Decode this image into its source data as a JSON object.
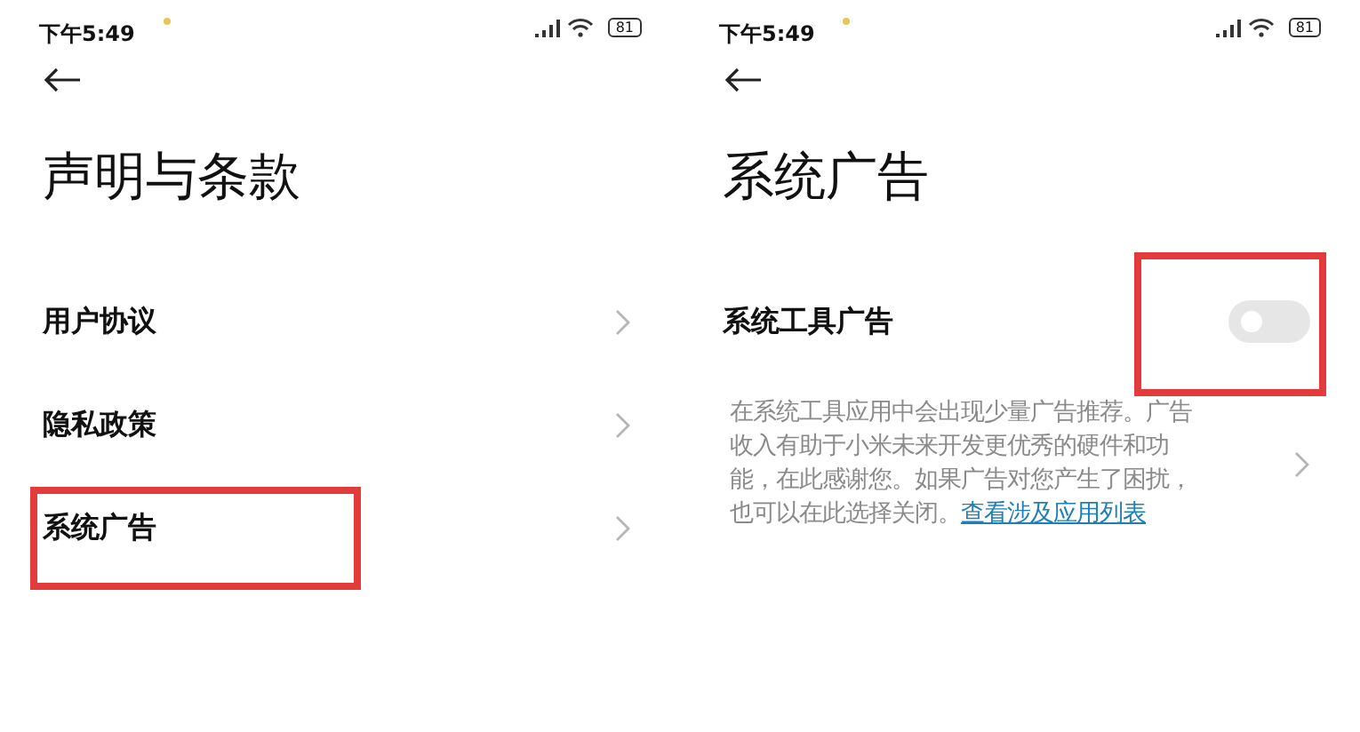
{
  "screens": [
    {
      "status_bar": {
        "time": "下午5:49",
        "battery": "81"
      },
      "title": "声明与条款",
      "items": [
        {
          "kind": "link",
          "label": "用户协议",
          "highlighted": false
        },
        {
          "kind": "link",
          "label": "隐私政策",
          "highlighted": false
        },
        {
          "kind": "link",
          "label": "系统广告",
          "highlighted": true
        }
      ]
    },
    {
      "status_bar": {
        "time": "下午5:49",
        "battery": "81"
      },
      "title": "系统广告",
      "items": [
        {
          "kind": "switch",
          "label": "系统工具广告",
          "on": false,
          "highlighted": true
        },
        {
          "kind": "note",
          "text": "在系统工具应用中会出现少量广告推荐。广告收入有助于小米未来开发更优秀的硬件和功能，在此感谢您。如果广告对您产生了困扰，也可以在此选择关闭。",
          "link": "查看涉及应用列表"
        }
      ]
    }
  ]
}
